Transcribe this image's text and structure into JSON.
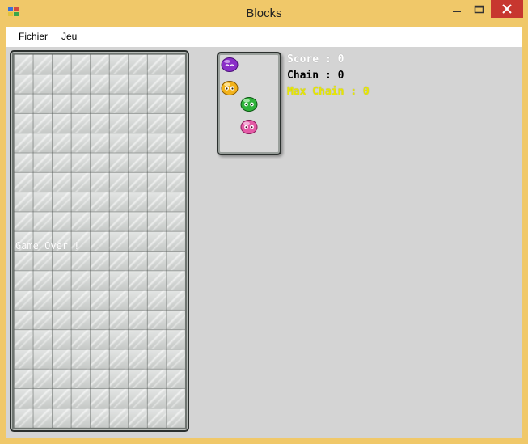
{
  "window": {
    "title": "Blocks"
  },
  "menu": {
    "items": [
      "Fichier",
      "Jeu"
    ]
  },
  "board": {
    "columns": 9,
    "rows": 19,
    "message": "Game Over !"
  },
  "next_pieces": [
    {
      "color": "purple",
      "fill": "#8a2ec8"
    },
    {
      "color": "yellow",
      "fill": "#f2b21a"
    },
    {
      "color": "green",
      "fill": "#2fb33a"
    },
    {
      "color": "pink",
      "fill": "#e45aa6"
    }
  ],
  "stats": {
    "score": "Score : 0",
    "chain": "Chain : 0",
    "max_chain": "Max Chain : 0"
  },
  "colors": {
    "title_bar": "#f0c869",
    "close_button": "#c7372f",
    "score_text": "#ffffff",
    "chain_text": "#000000",
    "max_chain_text": "#e8e800"
  }
}
